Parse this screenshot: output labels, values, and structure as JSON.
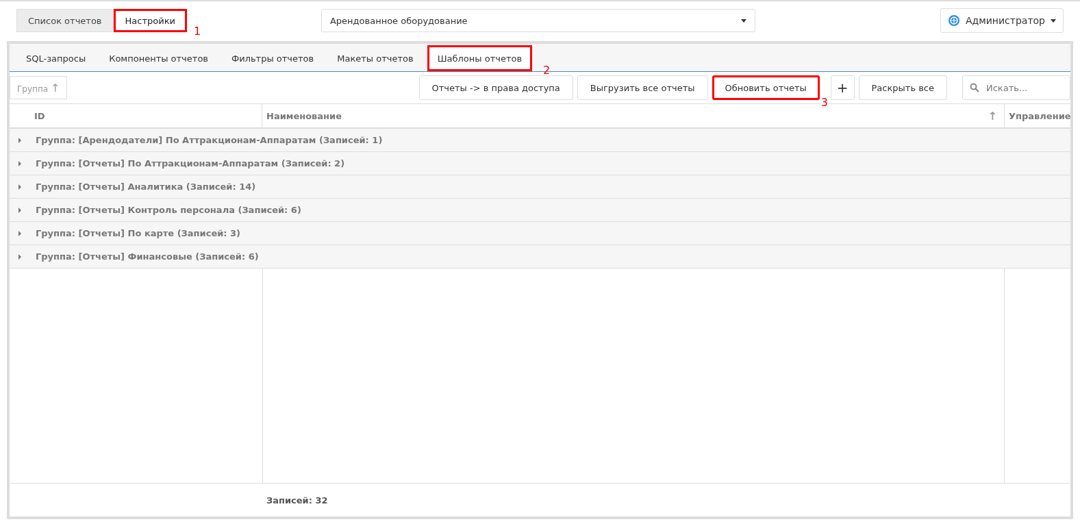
{
  "top_tabs": [
    {
      "label": "Список отчетов",
      "selected": false,
      "highlighted": false
    },
    {
      "label": "Настройки",
      "selected": true,
      "highlighted": true,
      "callout": "1"
    }
  ],
  "object_select": {
    "value": "Арендованное оборудование"
  },
  "user_menu": {
    "label": "Администратор"
  },
  "sub_tabs": [
    {
      "label": "SQL-запросы",
      "selected": false,
      "highlighted": false
    },
    {
      "label": "Компоненты отчетов",
      "selected": false,
      "highlighted": false
    },
    {
      "label": "Фильтры отчетов",
      "selected": false,
      "highlighted": false
    },
    {
      "label": "Макеты отчетов",
      "selected": false,
      "highlighted": false
    },
    {
      "label": "Шаблоны отчетов",
      "selected": true,
      "highlighted": true,
      "callout": "2"
    }
  ],
  "group_chip": {
    "label": "Группа",
    "sort": "↑"
  },
  "toolbar": [
    {
      "kind": "text",
      "label": "Отчеты -> в права доступа",
      "highlighted": false
    },
    {
      "kind": "text",
      "label": "Выгрузить все отчеты",
      "highlighted": false
    },
    {
      "kind": "text",
      "label": "Обновить отчеты",
      "highlighted": true,
      "callout": "3"
    },
    {
      "kind": "icon",
      "label": "+",
      "highlighted": false
    },
    {
      "kind": "text",
      "label": "Раскрыть все",
      "highlighted": false
    }
  ],
  "search": {
    "placeholder": "Искать..."
  },
  "table": {
    "columns": [
      {
        "label": "ID"
      },
      {
        "label": "Наименование",
        "sort": "↑"
      },
      {
        "label": "Управление"
      }
    ],
    "groups": [
      {
        "label": "Группа: [Арендодатели] По Аттракционам-Аппаратам (Записей: 1)",
        "expanded": false
      },
      {
        "label": "Группа: [Отчеты] По Аттракционам-Аппаратам (Записей: 2)",
        "expanded": false
      },
      {
        "label": "Группа: [Отчеты] Аналитика (Записей: 14)",
        "expanded": false
      },
      {
        "label": "Группа: [Отчеты] Контроль персонала (Записей: 6)",
        "expanded": false
      },
      {
        "label": "Группа: [Отчеты] По карте (Записей: 3)",
        "expanded": false
      },
      {
        "label": "Группа: [Отчеты] Финансовые (Записей: 6)",
        "expanded": false
      }
    ],
    "footer": "Записей: 32"
  }
}
